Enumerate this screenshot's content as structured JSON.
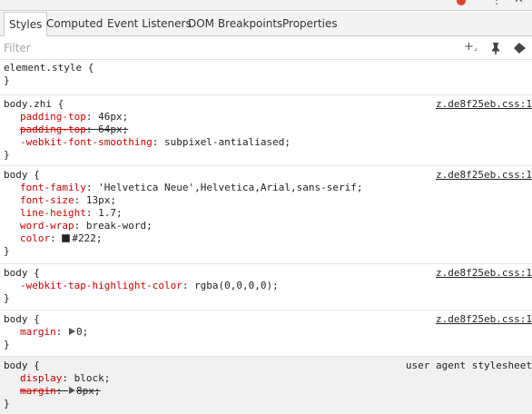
{
  "tabs": [
    "Styles",
    "Computed",
    "Event Listeners",
    "DOM Breakpoints",
    "Properties"
  ],
  "filter": {
    "placeholder": "Filter",
    "value": ""
  },
  "toolbar_icons": [
    "new-style-rule-icon",
    "pin-icon",
    "toggle-element-state-icon"
  ],
  "rules": [
    {
      "selector": "element.style {",
      "source": "",
      "declarations": []
    },
    {
      "selector": "body.zhi {",
      "source": "z.de8f25eb.css:1",
      "declarations": [
        {
          "prop": "padding-top",
          "value": "46px",
          "struck": false
        },
        {
          "prop": "padding-top",
          "value": "64px",
          "struck": true
        },
        {
          "prop": "-webkit-font-smoothing",
          "value": "subpixel-antialiased",
          "struck": false
        }
      ]
    },
    {
      "selector": "body {",
      "source": "z.de8f25eb.css:1",
      "declarations": [
        {
          "prop": "font-family",
          "value": "'Helvetica Neue',Helvetica,Arial,sans-serif",
          "struck": false
        },
        {
          "prop": "font-size",
          "value": "13px",
          "struck": false
        },
        {
          "prop": "line-height",
          "value": "1.7",
          "struck": false
        },
        {
          "prop": "word-wrap",
          "value": "break-word",
          "struck": false
        },
        {
          "prop": "color",
          "value": "#222",
          "struck": false,
          "swatch": "#222222"
        }
      ]
    },
    {
      "selector": "body {",
      "source": "z.de8f25eb.css:1",
      "declarations": [
        {
          "prop": "-webkit-tap-highlight-color",
          "value": "rgba(0,0,0,0)",
          "struck": false
        }
      ]
    },
    {
      "selector": "body {",
      "source": "z.de8f25eb.css:1",
      "declarations": [
        {
          "prop": "margin",
          "value": "0",
          "struck": false,
          "expand": true
        }
      ]
    },
    {
      "selector": "body {",
      "source": "user agent stylesheet",
      "declarations": [
        {
          "prop": "display",
          "value": "block",
          "struck": false
        },
        {
          "prop": "margin",
          "value": "8px",
          "struck": true,
          "expand": true
        }
      ]
    }
  ],
  "closing_brace": "}"
}
